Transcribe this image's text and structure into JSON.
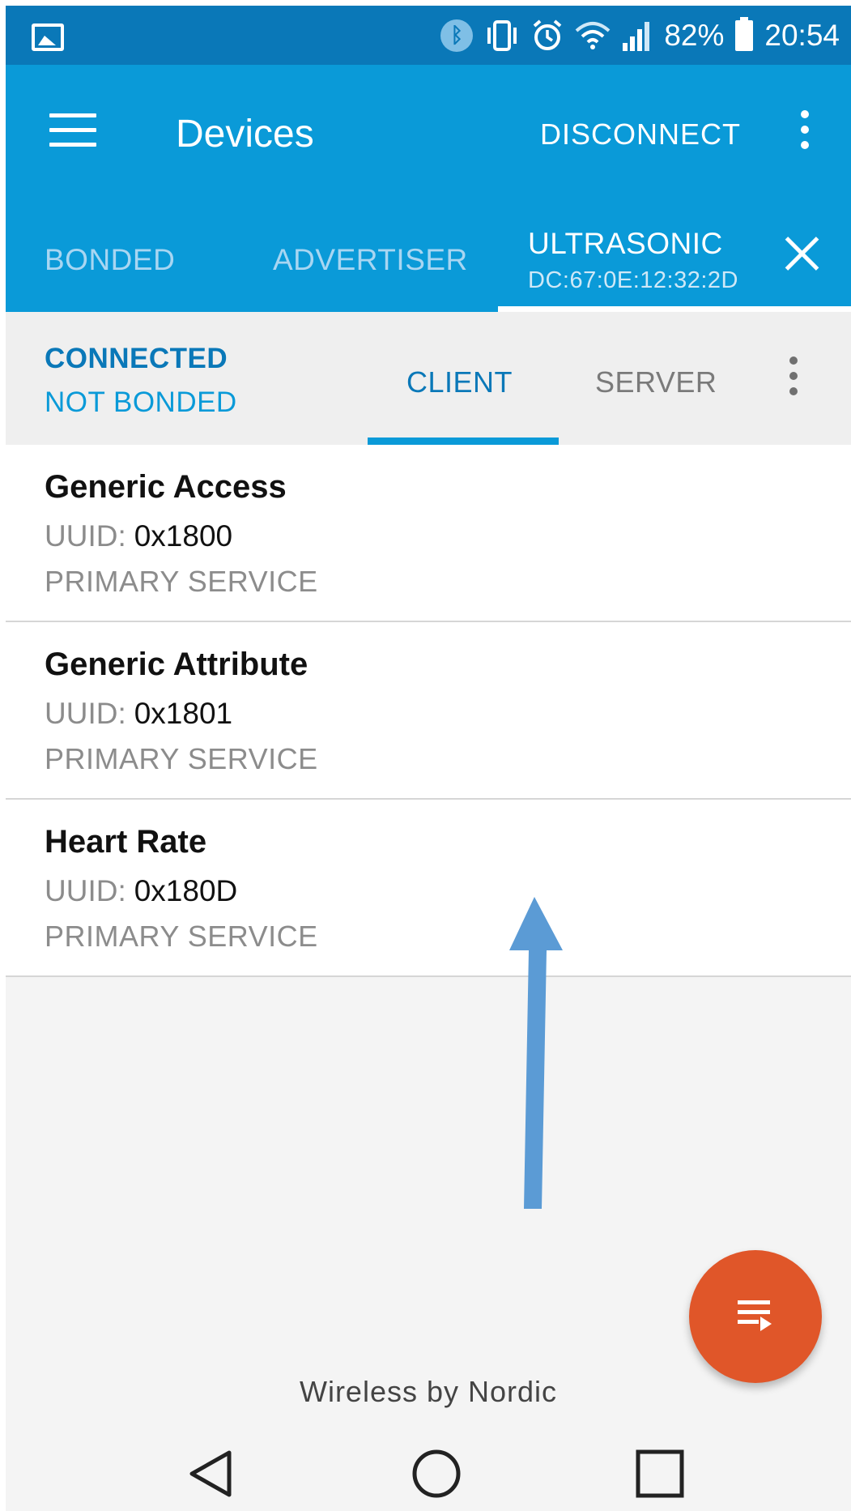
{
  "status_bar": {
    "battery_percent": "82%",
    "time": "20:54",
    "icons": [
      "gallery-icon",
      "bluetooth-icon",
      "vibrate-icon",
      "alarm-icon",
      "wifi-icon",
      "signal-icon",
      "battery-icon"
    ]
  },
  "app_bar": {
    "title": "Devices",
    "disconnect_label": "DISCONNECT"
  },
  "tabs": {
    "bonded": "BONDED",
    "advertiser": "ADVERTISER",
    "device_name": "ULTRASONIC",
    "device_mac": "DC:67:0E:12:32:2D"
  },
  "connection": {
    "state": "CONNECTED",
    "bond_state": "NOT BONDED",
    "client_tab": "CLIENT",
    "server_tab": "SERVER"
  },
  "services": [
    {
      "name": "Generic Access",
      "uuid_label": "UUID:",
      "uuid": "0x1800",
      "type": "PRIMARY SERVICE"
    },
    {
      "name": "Generic Attribute",
      "uuid_label": "UUID:",
      "uuid": "0x1801",
      "type": "PRIMARY SERVICE"
    },
    {
      "name": "Heart Rate",
      "uuid_label": "UUID:",
      "uuid": "0x180D",
      "type": "PRIMARY SERVICE"
    }
  ],
  "footer": "Wireless by Nordic",
  "colors": {
    "status_bar": "#0a78b8",
    "app_bar": "#0a9ad8",
    "fab": "#e05629",
    "arrow": "#5b9bd5"
  }
}
